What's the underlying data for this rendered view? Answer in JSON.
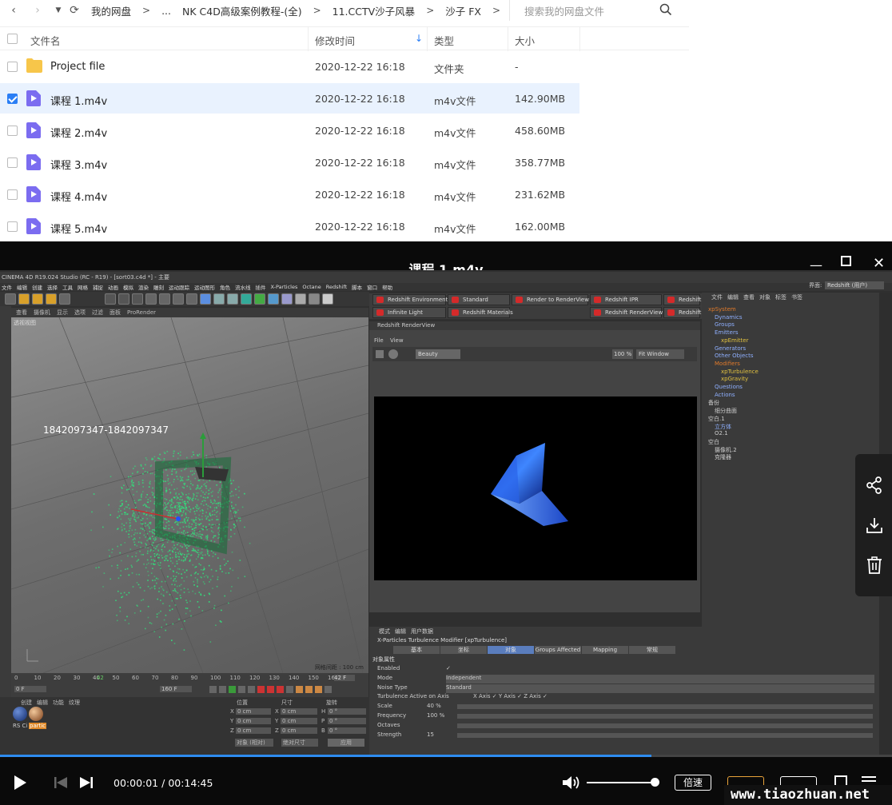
{
  "toolbar": {
    "back_icon": "chevron-left-icon",
    "forward_icon": "chevron-right-icon",
    "breadcrumb": [
      "我的网盘",
      "...",
      "NK C4D高级案例教程-(全)",
      "11.CCTV沙子风暴",
      "沙子 FX"
    ],
    "search_placeholder": "搜索我的网盘文件"
  },
  "file_list": {
    "columns": [
      "文件名",
      "修改时间",
      "类型",
      "大小"
    ],
    "rows": [
      {
        "name": "Project file",
        "modified": "2020-12-22 16:18",
        "type": "文件夹",
        "size": "-",
        "kind": "folder",
        "checked": false
      },
      {
        "name": "课程 1.m4v",
        "modified": "2020-12-22 16:18",
        "type": "m4v文件",
        "size": "142.90MB",
        "kind": "video",
        "checked": true
      },
      {
        "name": "课程 2.m4v",
        "modified": "2020-12-22 16:18",
        "type": "m4v文件",
        "size": "458.60MB",
        "kind": "video",
        "checked": false
      },
      {
        "name": "课程 3.m4v",
        "modified": "2020-12-22 16:18",
        "type": "m4v文件",
        "size": "358.77MB",
        "kind": "video",
        "checked": false
      },
      {
        "name": "课程 4.m4v",
        "modified": "2020-12-22 16:18",
        "type": "m4v文件",
        "size": "231.62MB",
        "kind": "video",
        "checked": false
      },
      {
        "name": "课程 5.m4v",
        "modified": "2020-12-22 16:18",
        "type": "m4v文件",
        "size": "162.00MB",
        "kind": "video",
        "checked": false
      }
    ]
  },
  "player": {
    "title": "课程 1.m4v",
    "time_current": "00:00:01",
    "time_total": "00:14:45",
    "speed_label": "倍速",
    "progress_fraction": 0.73,
    "volume_fraction": 0.95,
    "side_icons": [
      "share-icon",
      "download-icon",
      "trash-icon"
    ]
  },
  "video_content": {
    "app_title": "CINEMA 4D R19.024 Studio (RC - R19) - [sort03.c4d *] - 主要",
    "menu": [
      "文件",
      "编辑",
      "创建",
      "选择",
      "工具",
      "网格",
      "捕捉",
      "动画",
      "模拟",
      "渲染",
      "雕刻",
      "运动跟踪",
      "运动图形",
      "角色",
      "流水线",
      "插件",
      "X-Particles",
      "Octane",
      "Redshift",
      "脚本",
      "窗口",
      "帮助"
    ],
    "viewport_menu": [
      "查看",
      "摄像机",
      "显示",
      "选项",
      "过滤",
      "面板",
      "ProRender"
    ],
    "viewport_label": "透视视图",
    "watermark": "1842097347-1842097347",
    "grid_label": "网格间距 : 100 cm",
    "redshift_buttons": [
      "Redshift Environment",
      "Standard",
      "Render to RenderView",
      "Redshift IPR",
      "Redshift",
      "Infinite Light",
      "Redshift Materials",
      "Redshift RenderView",
      "Redshift"
    ],
    "renderview_title": "Redshift RenderView",
    "renderview_menu": [
      "File",
      "View"
    ],
    "renderview_aov": "Beauty",
    "renderview_zoom": "100 %",
    "renderview_fit": "Fit Window",
    "object_manager_menu": [
      "文件",
      "编辑",
      "查看",
      "对象",
      "标签",
      "书签"
    ],
    "objects": [
      "xpSystem",
      "Dynamics",
      "Groups",
      "Emitters",
      "xpEmitter",
      "Generators",
      "Other Objects",
      "Modifiers",
      "xpTurbulence",
      "xpGravity",
      "Questions",
      "Actions",
      "备份",
      "细分曲面",
      "空白.1",
      "立方体",
      "O2.1",
      "空白",
      "摄像机.2",
      "克隆器"
    ],
    "attr_menu": [
      "模式",
      "编辑",
      "用户数据"
    ],
    "attr_title": "X-Particles Turbulence Modifier [xpTurbulence]",
    "attr_tabs": [
      "基本",
      "坐标",
      "对象",
      "Groups Affected",
      "Mapping",
      "常规"
    ],
    "attr_section": "对象属性",
    "attr_rows": [
      {
        "label": "Enabled",
        "value": "✓"
      },
      {
        "label": "Mode",
        "value": "Independent"
      },
      {
        "label": "Noise Type",
        "value": "Standard"
      },
      {
        "label": "Turbulence Active on Axis",
        "value": "X Axis ✓  Y Axis ✓  Z Axis ✓"
      },
      {
        "label": "Scale",
        "value": "40 %"
      },
      {
        "label": "Frequency",
        "value": "100 %"
      },
      {
        "label": "Octaves",
        "value": ""
      },
      {
        "label": "Strength",
        "value": "15"
      }
    ],
    "timeline_ticks": [
      "0",
      "10",
      "20",
      "30",
      "40",
      "42",
      "50",
      "60",
      "70",
      "80",
      "90",
      "100",
      "110",
      "120",
      "130",
      "140",
      "150",
      "160"
    ],
    "timeline_frame": "42 F",
    "timeline_start": "0 F",
    "timeline_end": "160 F",
    "material_tabs": [
      "创建",
      "编辑",
      "功能",
      "纹理"
    ],
    "materials": [
      "RS Ci",
      "partic"
    ],
    "coord_headers": [
      "位置",
      "尺寸",
      "旋转"
    ],
    "coord_rows": [
      {
        "axis": "X",
        "pos": "0 cm",
        "size": "0 cm",
        "rot_axis": "H",
        "rot": "0 °"
      },
      {
        "axis": "Y",
        "pos": "0 cm",
        "size": "0 cm",
        "rot_axis": "P",
        "rot": "0 °"
      },
      {
        "axis": "Z",
        "pos": "0 cm",
        "size": "0 cm",
        "rot_axis": "B",
        "rot": "0 °"
      }
    ],
    "coord_mode": "对象 (相对)",
    "coord_size_mode": "绝对尺寸",
    "coord_apply": "应用",
    "layout_label": "界面:",
    "layout_value": "Redshift (用户)"
  },
  "site_watermark": "www.tiaozhuan.net",
  "colors": {
    "accent_blue": "#2a7ef5",
    "selected_row": "#e9f2fe",
    "video_icon": "#7b6cf0",
    "folder_icon": "#f7c64a",
    "particles_green": "#32e07c"
  }
}
